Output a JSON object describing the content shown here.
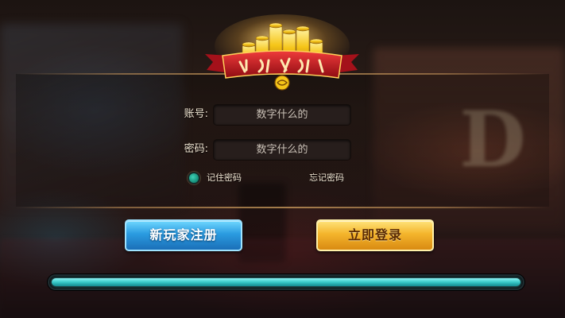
{
  "form": {
    "account_label": "账号:",
    "account_placeholder": "数字什么的",
    "password_label": "密码:",
    "password_placeholder": "数字什么的",
    "remember_label": "记住密码",
    "remember_checked": true,
    "forgot_label": "忘记密码"
  },
  "buttons": {
    "register_label": "新玩家注册",
    "login_label": "立即登录"
  },
  "progress": {
    "fraction": 1.0
  },
  "colors": {
    "register_button": "#2a9be0",
    "login_button": "#f4b52c",
    "progress_fill": "#36c7c7",
    "banner_red": "#c8161d",
    "coin_gold": "#f5c518"
  },
  "icons": {
    "logo": "gold-coins-banner-logo",
    "remember_toggle": "radio-dot-icon"
  }
}
